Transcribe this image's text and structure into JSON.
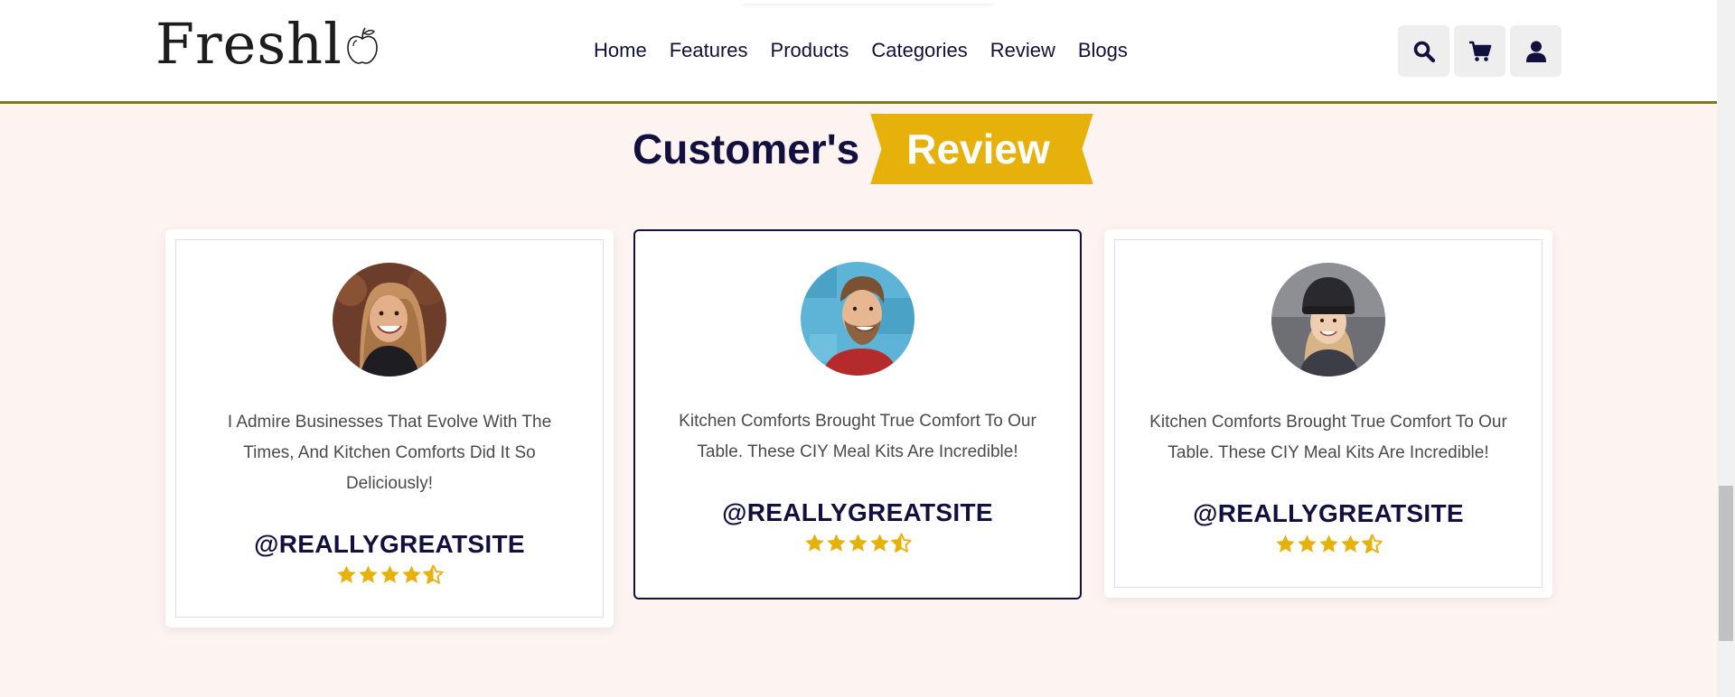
{
  "brand": {
    "name": "Freshl",
    "logo_icon": "apple-icon"
  },
  "nav": {
    "items": [
      {
        "label": "Home"
      },
      {
        "label": "Features"
      },
      {
        "label": "Products"
      },
      {
        "label": "Categories"
      },
      {
        "label": "Review"
      },
      {
        "label": "Blogs"
      }
    ]
  },
  "header_icons": [
    {
      "icon": "search-icon"
    },
    {
      "icon": "cart-icon"
    },
    {
      "icon": "user-icon"
    }
  ],
  "section": {
    "title_part1": "Customer's",
    "title_part2": "Review"
  },
  "reviews": [
    {
      "quote": "I Admire Businesses That Evolve With The Times, And Kitchen Comforts Did It So Deliciously!",
      "handle": "@REALLYGREATSITE",
      "rating": 4.5
    },
    {
      "quote": "Kitchen Comforts Brought True Comfort To Our Table. These CIY Meal Kits Are Incredible!",
      "handle": "@REALLYGREATSITE",
      "rating": 4.5
    },
    {
      "quote": "Kitchen Comforts Brought True Comfort To Our Table. These CIY Meal Kits Are Incredible!",
      "handle": "@REALLYGREATSITE",
      "rating": 4.5
    }
  ],
  "colors": {
    "navy": "#12103f",
    "accent_gold": "#e7b10c",
    "header_border": "#7d7a1a",
    "page_bg": "#fdf3f1"
  }
}
